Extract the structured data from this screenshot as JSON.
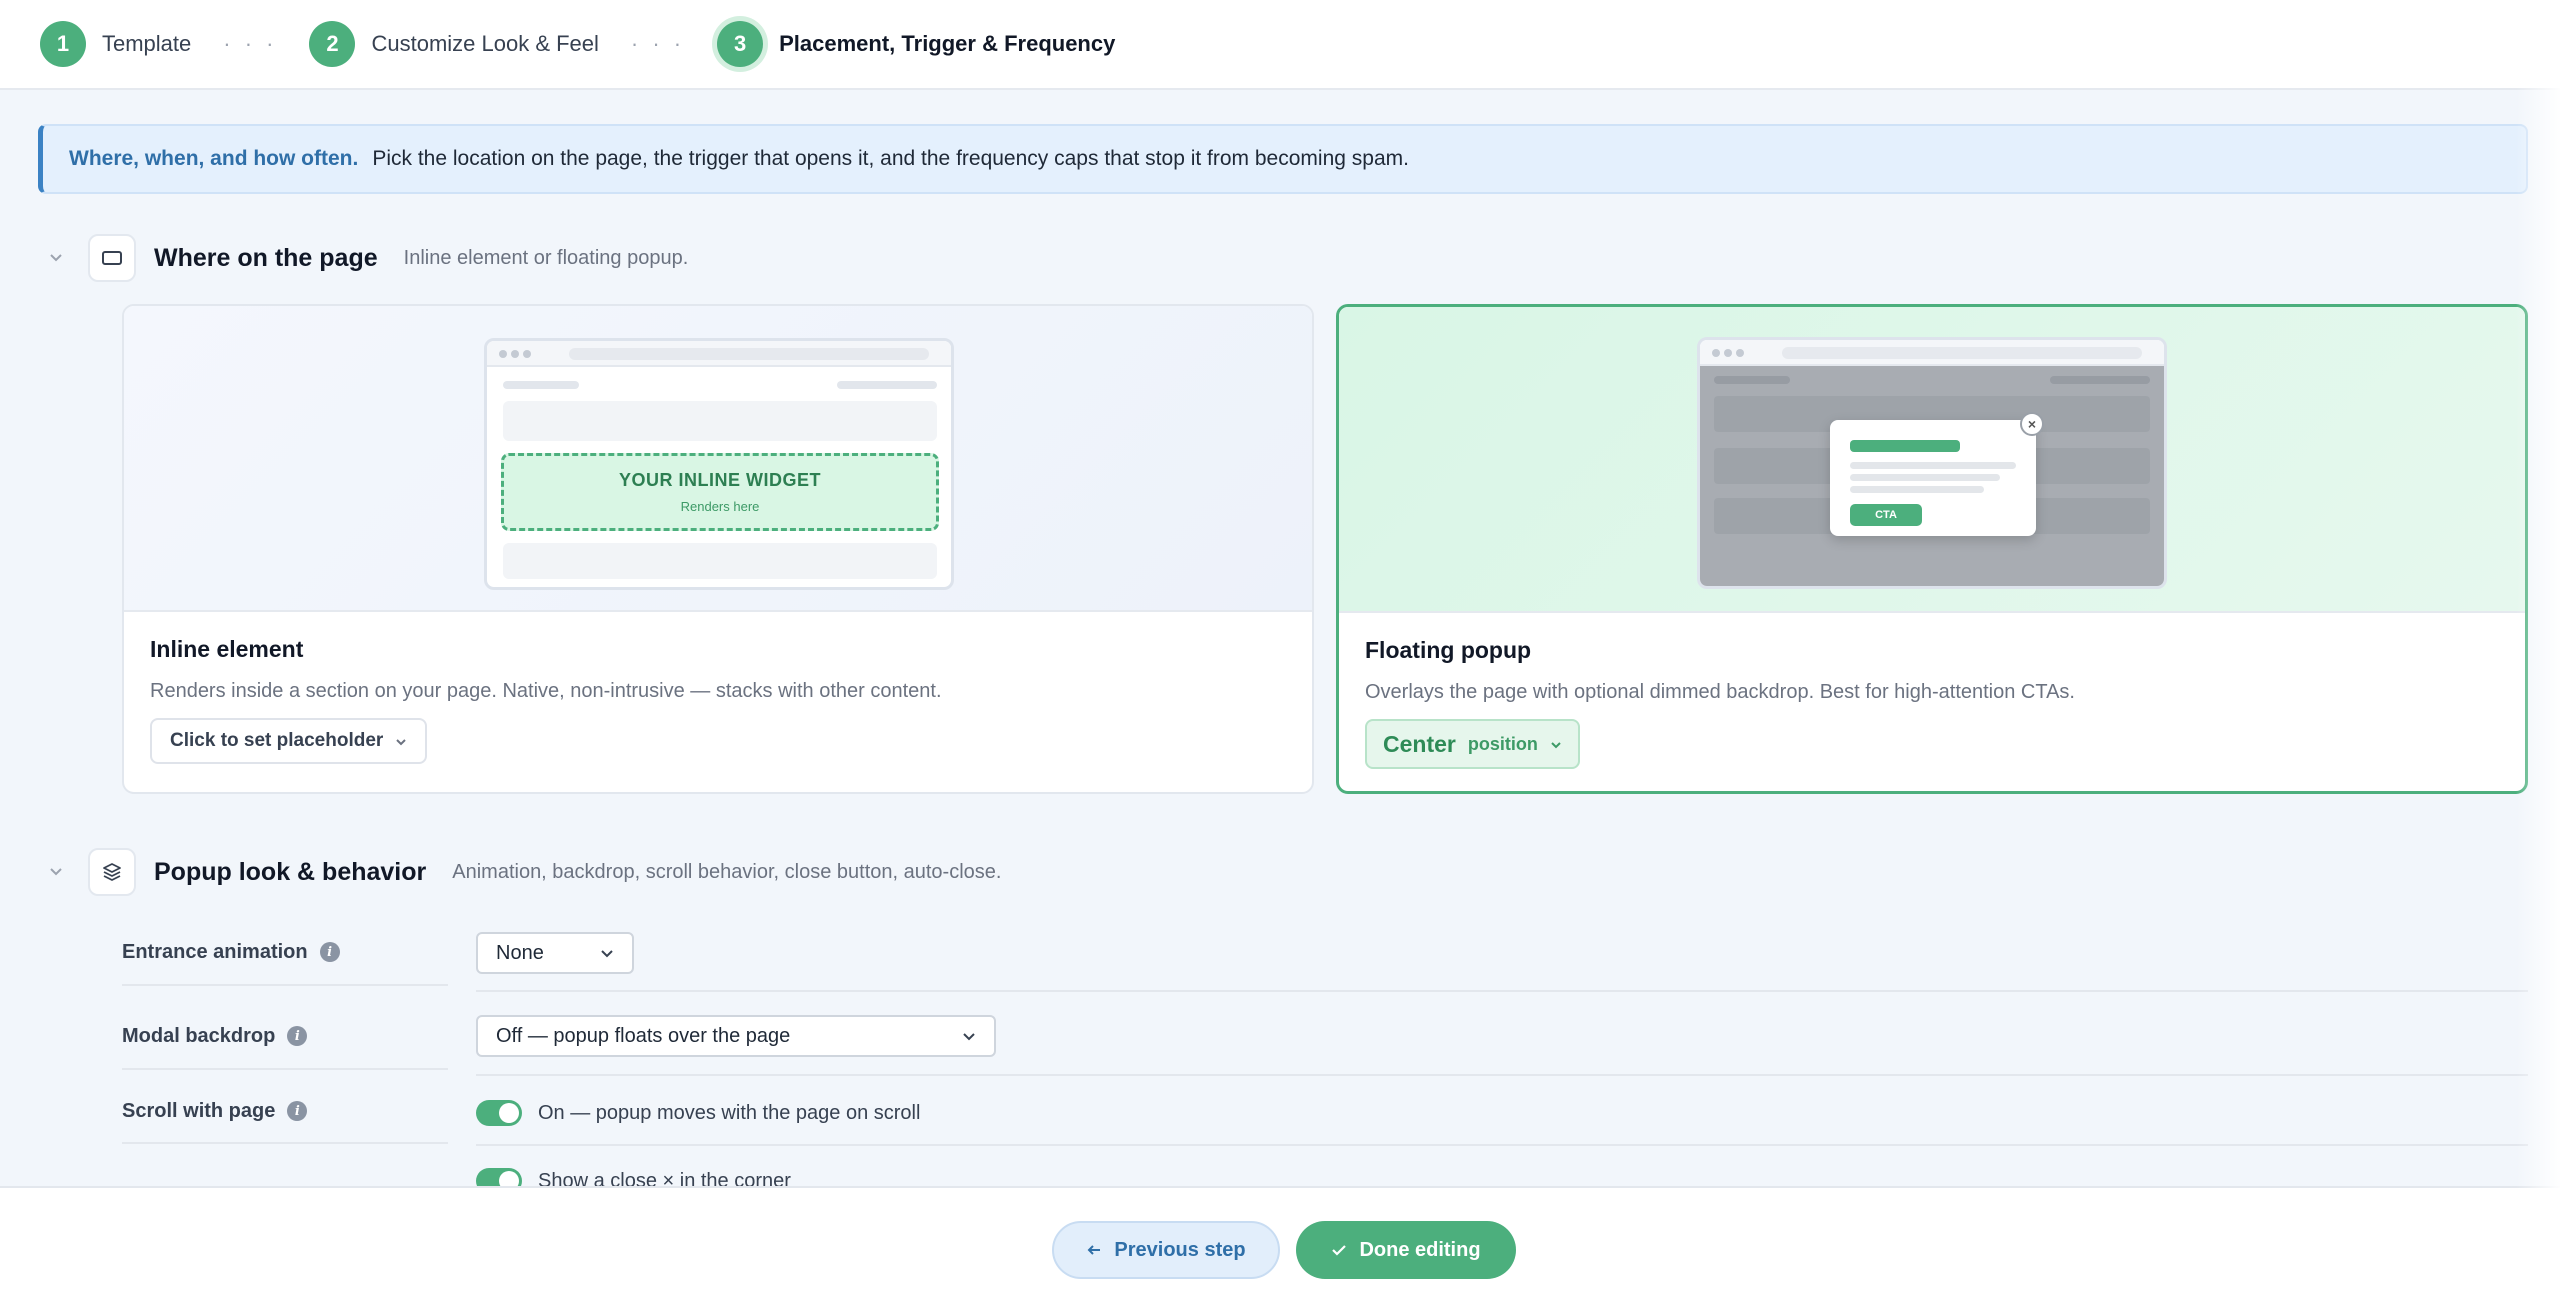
{
  "stepper": {
    "steps": [
      {
        "num": "1",
        "label": "Template"
      },
      {
        "num": "2",
        "label": "Customize Look & Feel"
      },
      {
        "num": "3",
        "label": "Placement, Trigger & Frequency"
      }
    ],
    "dots": "· · ·"
  },
  "banner": {
    "strong": "Where, when, and how often.",
    "text": "Pick the location on the page, the trigger that opens it, and the frequency caps that stop it from becoming spam."
  },
  "where": {
    "title": "Where on the page",
    "subtitle": "Inline element or floating popup."
  },
  "inline_card": {
    "title": "Inline element",
    "desc": "Renders inside a section on your page. Native, non-intrusive — stacks with other content.",
    "button": "Click to set placeholder",
    "widget_title": "YOUR INLINE WIDGET",
    "widget_sub": "Renders here"
  },
  "popup_card": {
    "title": "Floating popup",
    "desc": "Overlays the page with optional dimmed backdrop. Best for high-attention CTAs.",
    "position_value": "Center",
    "position_label": "position",
    "cta": "CTA",
    "close": "×"
  },
  "behavior": {
    "title": "Popup look & behavior",
    "subtitle": "Animation, backdrop, scroll behavior, close button, auto-close.",
    "rows": [
      {
        "label": "Entrance animation",
        "value": "None"
      },
      {
        "label": "Modal backdrop",
        "value": "Off — popup floats over the page"
      },
      {
        "label": "Scroll with page",
        "value": "On — popup moves with the page on scroll"
      },
      {
        "label": "",
        "value": "Show a close × in the corner"
      }
    ]
  },
  "footer": {
    "prev": "Previous step",
    "done": "Done editing"
  },
  "colors": {
    "accent": "#4caf7d",
    "info": "#3b82c4"
  }
}
